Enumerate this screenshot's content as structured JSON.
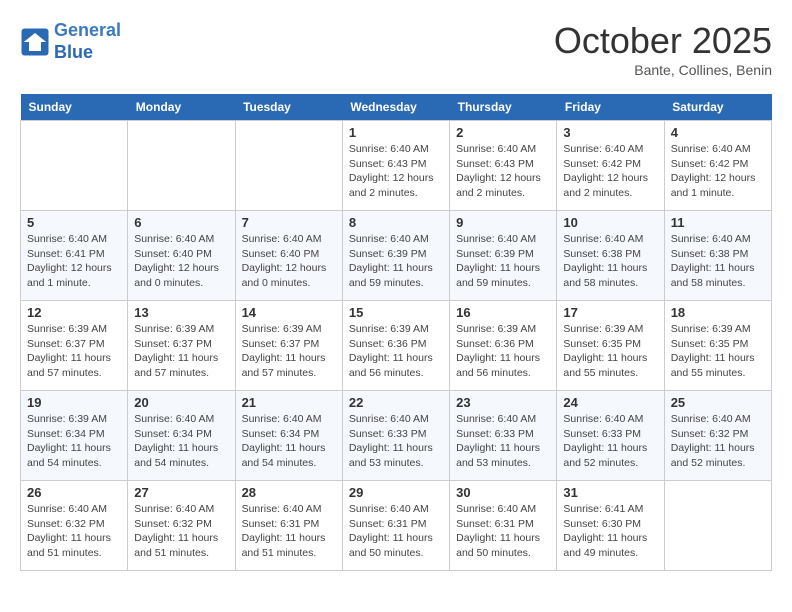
{
  "header": {
    "logo_line1": "General",
    "logo_line2": "Blue",
    "month": "October 2025",
    "location": "Bante, Collines, Benin"
  },
  "weekdays": [
    "Sunday",
    "Monday",
    "Tuesday",
    "Wednesday",
    "Thursday",
    "Friday",
    "Saturday"
  ],
  "weeks": [
    [
      {
        "day": "",
        "info": ""
      },
      {
        "day": "",
        "info": ""
      },
      {
        "day": "",
        "info": ""
      },
      {
        "day": "1",
        "info": "Sunrise: 6:40 AM\nSunset: 6:43 PM\nDaylight: 12 hours\nand 2 minutes."
      },
      {
        "day": "2",
        "info": "Sunrise: 6:40 AM\nSunset: 6:43 PM\nDaylight: 12 hours\nand 2 minutes."
      },
      {
        "day": "3",
        "info": "Sunrise: 6:40 AM\nSunset: 6:42 PM\nDaylight: 12 hours\nand 2 minutes."
      },
      {
        "day": "4",
        "info": "Sunrise: 6:40 AM\nSunset: 6:42 PM\nDaylight: 12 hours\nand 1 minute."
      }
    ],
    [
      {
        "day": "5",
        "info": "Sunrise: 6:40 AM\nSunset: 6:41 PM\nDaylight: 12 hours\nand 1 minute."
      },
      {
        "day": "6",
        "info": "Sunrise: 6:40 AM\nSunset: 6:40 PM\nDaylight: 12 hours\nand 0 minutes."
      },
      {
        "day": "7",
        "info": "Sunrise: 6:40 AM\nSunset: 6:40 PM\nDaylight: 12 hours\nand 0 minutes."
      },
      {
        "day": "8",
        "info": "Sunrise: 6:40 AM\nSunset: 6:39 PM\nDaylight: 11 hours\nand 59 minutes."
      },
      {
        "day": "9",
        "info": "Sunrise: 6:40 AM\nSunset: 6:39 PM\nDaylight: 11 hours\nand 59 minutes."
      },
      {
        "day": "10",
        "info": "Sunrise: 6:40 AM\nSunset: 6:38 PM\nDaylight: 11 hours\nand 58 minutes."
      },
      {
        "day": "11",
        "info": "Sunrise: 6:40 AM\nSunset: 6:38 PM\nDaylight: 11 hours\nand 58 minutes."
      }
    ],
    [
      {
        "day": "12",
        "info": "Sunrise: 6:39 AM\nSunset: 6:37 PM\nDaylight: 11 hours\nand 57 minutes."
      },
      {
        "day": "13",
        "info": "Sunrise: 6:39 AM\nSunset: 6:37 PM\nDaylight: 11 hours\nand 57 minutes."
      },
      {
        "day": "14",
        "info": "Sunrise: 6:39 AM\nSunset: 6:37 PM\nDaylight: 11 hours\nand 57 minutes."
      },
      {
        "day": "15",
        "info": "Sunrise: 6:39 AM\nSunset: 6:36 PM\nDaylight: 11 hours\nand 56 minutes."
      },
      {
        "day": "16",
        "info": "Sunrise: 6:39 AM\nSunset: 6:36 PM\nDaylight: 11 hours\nand 56 minutes."
      },
      {
        "day": "17",
        "info": "Sunrise: 6:39 AM\nSunset: 6:35 PM\nDaylight: 11 hours\nand 55 minutes."
      },
      {
        "day": "18",
        "info": "Sunrise: 6:39 AM\nSunset: 6:35 PM\nDaylight: 11 hours\nand 55 minutes."
      }
    ],
    [
      {
        "day": "19",
        "info": "Sunrise: 6:39 AM\nSunset: 6:34 PM\nDaylight: 11 hours\nand 54 minutes."
      },
      {
        "day": "20",
        "info": "Sunrise: 6:40 AM\nSunset: 6:34 PM\nDaylight: 11 hours\nand 54 minutes."
      },
      {
        "day": "21",
        "info": "Sunrise: 6:40 AM\nSunset: 6:34 PM\nDaylight: 11 hours\nand 54 minutes."
      },
      {
        "day": "22",
        "info": "Sunrise: 6:40 AM\nSunset: 6:33 PM\nDaylight: 11 hours\nand 53 minutes."
      },
      {
        "day": "23",
        "info": "Sunrise: 6:40 AM\nSunset: 6:33 PM\nDaylight: 11 hours\nand 53 minutes."
      },
      {
        "day": "24",
        "info": "Sunrise: 6:40 AM\nSunset: 6:33 PM\nDaylight: 11 hours\nand 52 minutes."
      },
      {
        "day": "25",
        "info": "Sunrise: 6:40 AM\nSunset: 6:32 PM\nDaylight: 11 hours\nand 52 minutes."
      }
    ],
    [
      {
        "day": "26",
        "info": "Sunrise: 6:40 AM\nSunset: 6:32 PM\nDaylight: 11 hours\nand 51 minutes."
      },
      {
        "day": "27",
        "info": "Sunrise: 6:40 AM\nSunset: 6:32 PM\nDaylight: 11 hours\nand 51 minutes."
      },
      {
        "day": "28",
        "info": "Sunrise: 6:40 AM\nSunset: 6:31 PM\nDaylight: 11 hours\nand 51 minutes."
      },
      {
        "day": "29",
        "info": "Sunrise: 6:40 AM\nSunset: 6:31 PM\nDaylight: 11 hours\nand 50 minutes."
      },
      {
        "day": "30",
        "info": "Sunrise: 6:40 AM\nSunset: 6:31 PM\nDaylight: 11 hours\nand 50 minutes."
      },
      {
        "day": "31",
        "info": "Sunrise: 6:41 AM\nSunset: 6:30 PM\nDaylight: 11 hours\nand 49 minutes."
      },
      {
        "day": "",
        "info": ""
      }
    ]
  ]
}
